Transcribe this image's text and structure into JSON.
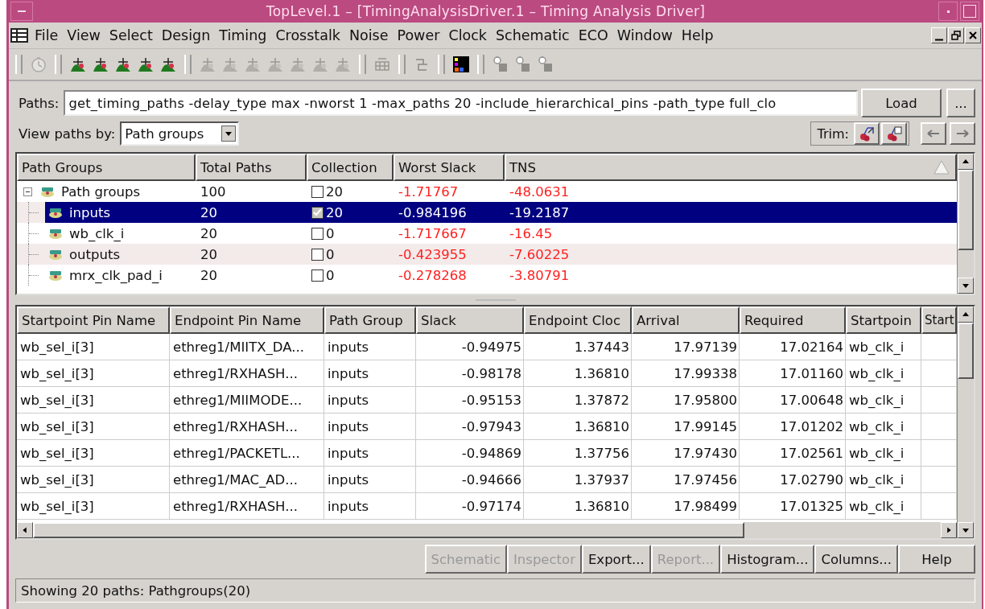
{
  "window": {
    "title": "TopLevel.1 – [TimingAnalysisDriver.1 – Timing Analysis Driver]"
  },
  "menu": [
    "File",
    "View",
    "Select",
    "Design",
    "Timing",
    "Crosstalk",
    "Noise",
    "Power",
    "Clock",
    "Schematic",
    "ECO",
    "Window",
    "Help"
  ],
  "toolbar": [
    [
      {
        "kind": "clock",
        "disabled": true
      }
    ],
    [
      {
        "kind": "hill",
        "disabled": false
      },
      {
        "kind": "hill",
        "disabled": false
      },
      {
        "kind": "hill",
        "disabled": false
      },
      {
        "kind": "hill",
        "disabled": false
      },
      {
        "kind": "hill",
        "disabled": false
      }
    ],
    [
      {
        "kind": "hill",
        "disabled": true
      },
      {
        "kind": "hill",
        "disabled": true
      },
      {
        "kind": "hill",
        "disabled": true
      },
      {
        "kind": "hill",
        "disabled": true
      },
      {
        "kind": "hill",
        "disabled": true
      },
      {
        "kind": "hill",
        "disabled": true
      },
      {
        "kind": "hill",
        "disabled": true
      }
    ],
    [
      {
        "kind": "grid",
        "disabled": true
      }
    ],
    [
      {
        "kind": "step",
        "disabled": true
      }
    ],
    [
      {
        "kind": "colormap",
        "disabled": false
      }
    ],
    [
      {
        "kind": "pointer",
        "disabled": true
      },
      {
        "kind": "pointer",
        "disabled": true
      },
      {
        "kind": "pointer",
        "disabled": true
      }
    ]
  ],
  "paths": {
    "label": "Paths:",
    "value": "get_timing_paths -delay_type max -nworst 1 -max_paths 20 -include_hierarchical_pins -path_type full_clo",
    "load": "Load",
    "more": "..."
  },
  "view_by": {
    "label": "View paths by:",
    "value": "Path groups"
  },
  "trim": {
    "label": "Trim:"
  },
  "tree": {
    "columns": [
      "Path Groups",
      "Total Paths",
      "Collection",
      "Worst Slack",
      "TNS"
    ],
    "rows": [
      {
        "name": "Path groups",
        "total": "100",
        "checked": false,
        "count": "20",
        "worst_slack": "-1.71767",
        "tns": "-48.0631",
        "selected": false,
        "expanded": true,
        "children": [
          {
            "name": "inputs",
            "total": "20",
            "checked": true,
            "count": "20",
            "worst_slack": "-0.984196",
            "tns": "-19.2187",
            "selected": true
          },
          {
            "name": "wb_clk_i",
            "total": "20",
            "checked": false,
            "count": "0",
            "worst_slack": "-1.717667",
            "tns": "-16.45",
            "selected": false
          },
          {
            "name": "outputs",
            "total": "20",
            "checked": false,
            "count": "0",
            "worst_slack": "-0.423955",
            "tns": "-7.60225",
            "selected": false
          },
          {
            "name": "mrx_clk_pad_i",
            "total": "20",
            "checked": false,
            "count": "0",
            "worst_slack": "-0.278268",
            "tns": "-3.80791",
            "selected": false
          }
        ]
      }
    ]
  },
  "table": {
    "columns": [
      "Startpoint Pin Name",
      "Endpoint Pin Name",
      "Path Group",
      "Slack",
      "Endpoint Cloc",
      "Arrival",
      "Required",
      "Startpoin",
      "Start"
    ],
    "rows": [
      [
        "wb_sel_i[3]",
        "ethreg1/MIITX_DA...",
        "inputs",
        "-0.94975",
        "1.37443",
        "17.97139",
        "17.02164",
        "wb_clk_i"
      ],
      [
        "wb_sel_i[3]",
        "ethreg1/RXHASH...",
        "inputs",
        "-0.98178",
        "1.36810",
        "17.99338",
        "17.01160",
        "wb_clk_i"
      ],
      [
        "wb_sel_i[3]",
        "ethreg1/MIIMODE...",
        "inputs",
        "-0.95153",
        "1.37872",
        "17.95800",
        "17.00648",
        "wb_clk_i"
      ],
      [
        "wb_sel_i[3]",
        "ethreg1/RXHASH...",
        "inputs",
        "-0.97943",
        "1.36810",
        "17.99145",
        "17.01202",
        "wb_clk_i"
      ],
      [
        "wb_sel_i[3]",
        "ethreg1/PACKETL...",
        "inputs",
        "-0.94869",
        "1.37756",
        "17.97430",
        "17.02561",
        "wb_clk_i"
      ],
      [
        "wb_sel_i[3]",
        "ethreg1/MAC_AD...",
        "inputs",
        "-0.94666",
        "1.37937",
        "17.97456",
        "17.02790",
        "wb_clk_i"
      ],
      [
        "wb_sel_i[3]",
        "ethreg1/RXHASH...",
        "inputs",
        "-0.97174",
        "1.36810",
        "17.98499",
        "17.01325",
        "wb_clk_i"
      ]
    ]
  },
  "buttons": [
    {
      "label": "Schematic",
      "disabled": true
    },
    {
      "label": "Inspector",
      "disabled": true
    },
    {
      "label": "Export...",
      "disabled": false
    },
    {
      "label": "Report...",
      "disabled": true
    },
    {
      "label": "Histogram...",
      "disabled": false
    },
    {
      "label": "Columns...",
      "disabled": false
    },
    {
      "label": "Help",
      "disabled": false
    }
  ],
  "status_bar": "Showing 20 paths: Pathgroups(20)"
}
